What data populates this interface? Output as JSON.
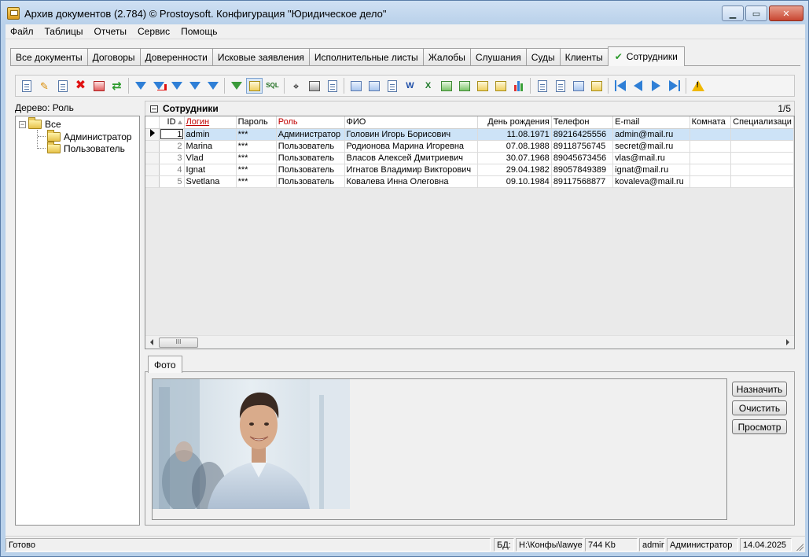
{
  "window": {
    "title": "Архив документов (2.784) © Prostoysoft. Конфигурация \"Юридическое дело\""
  },
  "menu": [
    "Файл",
    "Таблицы",
    "Отчеты",
    "Сервис",
    "Помощь"
  ],
  "tabs": [
    {
      "label": "Все документы",
      "active": false
    },
    {
      "label": "Договоры",
      "active": false
    },
    {
      "label": "Доверенности",
      "active": false
    },
    {
      "label": "Исковые заявления",
      "active": false
    },
    {
      "label": "Исполнительные листы",
      "active": false
    },
    {
      "label": "Жалобы",
      "active": false
    },
    {
      "label": "Слушания",
      "active": false
    },
    {
      "label": "Суды",
      "active": false
    },
    {
      "label": "Клиенты",
      "active": false
    },
    {
      "label": "Сотрудники",
      "active": true
    }
  ],
  "toolbar": {
    "buttons": [
      {
        "name": "add-record",
        "icon": "doc-add-icon"
      },
      {
        "name": "edit-record",
        "icon": "pencil-icon"
      },
      {
        "name": "copy-record",
        "icon": "copy-icon"
      },
      {
        "name": "delete-record",
        "icon": "red-x-icon"
      },
      {
        "name": "delete-all",
        "icon": "delete-table-icon"
      },
      {
        "name": "refresh",
        "icon": "refresh-icon"
      },
      {
        "name": "filter",
        "icon": "filter-icon"
      },
      {
        "name": "filter-clear",
        "icon": "filter-clear-icon"
      },
      {
        "name": "filter-remove",
        "icon": "filter-remove-icon"
      },
      {
        "name": "filter-edit",
        "icon": "filter-edit-icon"
      },
      {
        "name": "filter-apply",
        "icon": "filter-apply-icon"
      },
      {
        "name": "group-filter",
        "icon": "filter-group-icon"
      },
      {
        "name": "tree-view",
        "icon": "tree-icon"
      },
      {
        "name": "sql-query",
        "icon": "sql-icon"
      },
      {
        "name": "search",
        "icon": "binoculars-icon"
      },
      {
        "name": "print",
        "icon": "printer-icon"
      },
      {
        "name": "preview",
        "icon": "preview-icon"
      },
      {
        "name": "export-word",
        "icon": "word-icon"
      },
      {
        "name": "export-word-all",
        "icon": "word-table-icon"
      },
      {
        "name": "export-doc",
        "icon": "doc-export-icon"
      },
      {
        "name": "export-word-template",
        "icon": "word-template-icon"
      },
      {
        "name": "export-excel",
        "icon": "excel-icon"
      },
      {
        "name": "export-excel-all",
        "icon": "excel-table-icon"
      },
      {
        "name": "export-csv",
        "icon": "csv-icon"
      },
      {
        "name": "export-txt",
        "icon": "txt-icon"
      },
      {
        "name": "export-xml",
        "icon": "xml-icon"
      },
      {
        "name": "chart",
        "icon": "bar-chart-icon"
      },
      {
        "name": "import",
        "icon": "import-icon"
      },
      {
        "name": "attach",
        "icon": "attach-icon"
      },
      {
        "name": "table-settings",
        "icon": "table-settings-icon"
      },
      {
        "name": "columns",
        "icon": "columns-icon"
      },
      {
        "name": "first-record",
        "icon": "first-icon"
      },
      {
        "name": "prev-record",
        "icon": "prev-icon"
      },
      {
        "name": "next-record",
        "icon": "next-icon"
      },
      {
        "name": "last-record",
        "icon": "last-icon"
      },
      {
        "name": "warning",
        "icon": "warning-icon"
      }
    ]
  },
  "tree": {
    "label": "Дерево: Роль",
    "root": "Все",
    "children": [
      "Администратор",
      "Пользователь"
    ]
  },
  "grid": {
    "title": "Сотрудники",
    "counter": "1/5",
    "columns": [
      {
        "label": "ID",
        "sort": true
      },
      {
        "label": "Логин",
        "color": "red",
        "underline": true
      },
      {
        "label": "Пароль"
      },
      {
        "label": "Роль",
        "color": "red"
      },
      {
        "label": "ФИО"
      },
      {
        "label": "День рождения"
      },
      {
        "label": "Телефон"
      },
      {
        "label": "E-mail"
      },
      {
        "label": "Комната"
      },
      {
        "label": "Специализаци"
      }
    ],
    "rows": [
      {
        "id": "1",
        "login": "admin",
        "password": "***",
        "role": "Администратор",
        "fio": "Головин Игорь Борисович",
        "birthday": "11.08.1971",
        "phone": "89216425556",
        "email": "admin@mail.ru",
        "room": "",
        "spec": "",
        "selected": true
      },
      {
        "id": "2",
        "login": "Marina",
        "password": "***",
        "role": "Пользователь",
        "fio": "Родионова Марина Игоревна",
        "birthday": "07.08.1988",
        "phone": "89118756745",
        "email": "secret@mail.ru",
        "room": "",
        "spec": ""
      },
      {
        "id": "3",
        "login": "Vlad",
        "password": "***",
        "role": "Пользователь",
        "fio": "Власов Алексей Дмитриевич",
        "birthday": "30.07.1968",
        "phone": "89045673456",
        "email": "vlas@mail.ru",
        "room": "",
        "spec": ""
      },
      {
        "id": "4",
        "login": "Ignat",
        "password": "***",
        "role": "Пользователь",
        "fio": "Игнатов Владимир Викторович",
        "birthday": "29.04.1982",
        "phone": "89057849389",
        "email": "ignat@mail.ru",
        "room": "",
        "spec": ""
      },
      {
        "id": "5",
        "login": "Svetlana",
        "password": "***",
        "role": "Пользователь",
        "fio": "Ковалева Инна Олеговна",
        "birthday": "09.10.1984",
        "phone": "89117568877",
        "email": "kovaleva@mail.ru",
        "room": "",
        "spec": ""
      }
    ],
    "scroll_thumb": "III"
  },
  "photo": {
    "tab_label": "Фото",
    "buttons": {
      "assign": "Назначить",
      "clear": "Очистить",
      "view": "Просмотр"
    }
  },
  "statusbar": {
    "status": "Готово",
    "db_label": "БД:",
    "db_path": "H:\\Конфы\\lawyer.mdb",
    "db_size": "744 Kb",
    "user": "admin",
    "role": "Администратор",
    "date": "14.04.2025"
  }
}
